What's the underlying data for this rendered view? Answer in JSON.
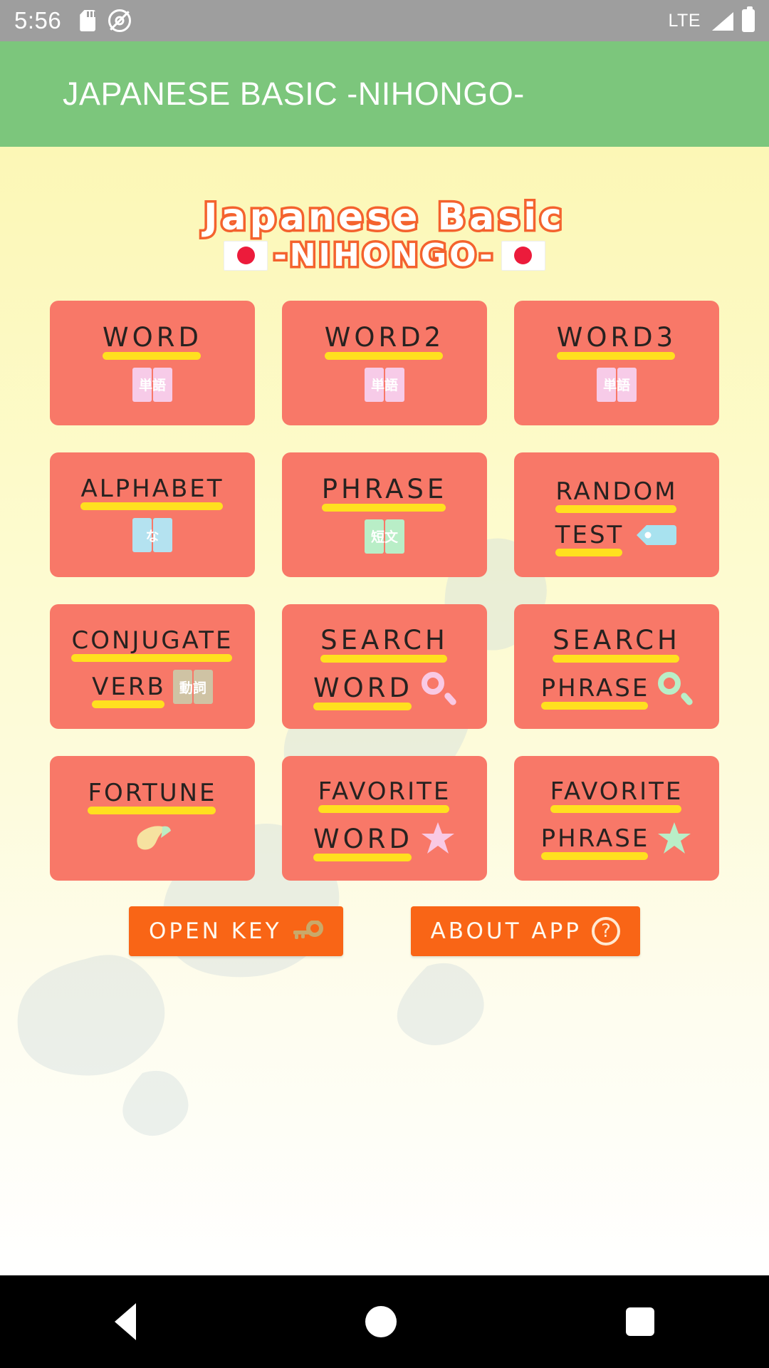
{
  "status_bar": {
    "clock": "5:56",
    "network_label": "LTE",
    "icons": [
      "sd-card-icon",
      "do-not-disturb-icon",
      "signal-icon",
      "battery-icon"
    ]
  },
  "app_bar": {
    "title": "JAPANESE BASIC -NIHONGO-",
    "background": "#7cc67c"
  },
  "logo": {
    "line1": "Japanese Basic",
    "line2": "-NIHONGO-",
    "flag_left": "japan-flag",
    "flag_right": "japan-flag",
    "outline_color": "#f4622e"
  },
  "theme": {
    "tile_color": "#f87868",
    "underline_color": "#ffe01f",
    "button_color": "#f96516",
    "page_background": "#fcf7b6"
  },
  "grid": {
    "tiles": [
      {
        "id": "word",
        "line1": "WORD",
        "line2": "",
        "icon": "pink-book",
        "icon_text": "単語",
        "icon_position": "below"
      },
      {
        "id": "word2",
        "line1": "WORD2",
        "line2": "",
        "icon": "pink-book",
        "icon_text": "単語",
        "icon_position": "below"
      },
      {
        "id": "word3",
        "line1": "WORD3",
        "line2": "",
        "icon": "pink-book",
        "icon_text": "単語",
        "icon_position": "below"
      },
      {
        "id": "alphabet",
        "line1": "ALPHABET",
        "line2": "",
        "icon": "blue-book",
        "icon_text": "な",
        "icon_position": "below"
      },
      {
        "id": "phrase",
        "line1": "PHRASE",
        "line2": "",
        "icon": "green-book",
        "icon_text": "短文",
        "icon_position": "below"
      },
      {
        "id": "random-test",
        "line1": "RANDOM",
        "line2": "TEST",
        "icon": "tag",
        "icon_text": "",
        "icon_position": "inline"
      },
      {
        "id": "conjugate-verb",
        "line1": "CONJUGATE",
        "line2": "VERB",
        "icon": "tan-book",
        "icon_text": "動詞",
        "icon_position": "inline"
      },
      {
        "id": "search-word",
        "line1": "SEARCH",
        "line2": "WORD",
        "icon": "magnifier-pink",
        "icon_text": "",
        "icon_position": "inline"
      },
      {
        "id": "search-phrase",
        "line1": "SEARCH",
        "line2": "PHRASE",
        "icon": "magnifier-green",
        "icon_text": "",
        "icon_position": "inline"
      },
      {
        "id": "fortune",
        "line1": "FORTUNE",
        "line2": "",
        "icon": "fortune-cookie",
        "icon_text": "",
        "icon_position": "below"
      },
      {
        "id": "favorite-word",
        "line1": "FAVORITE",
        "line2": "WORD",
        "icon": "star-pink",
        "icon_text": "",
        "icon_position": "inline"
      },
      {
        "id": "favorite-phrase",
        "line1": "FAVORITE",
        "line2": "PHRASE",
        "icon": "star-green",
        "icon_text": "",
        "icon_position": "inline"
      }
    ]
  },
  "bottom_buttons": [
    {
      "id": "open-key",
      "label": "OPEN KEY",
      "icon": "key-icon"
    },
    {
      "id": "about-app",
      "label": "ABOUT APP",
      "icon": "question-mark-icon"
    }
  ],
  "nav_bar": {
    "back": "back-triangle-icon",
    "home": "home-circle-icon",
    "recents": "recents-square-icon"
  }
}
